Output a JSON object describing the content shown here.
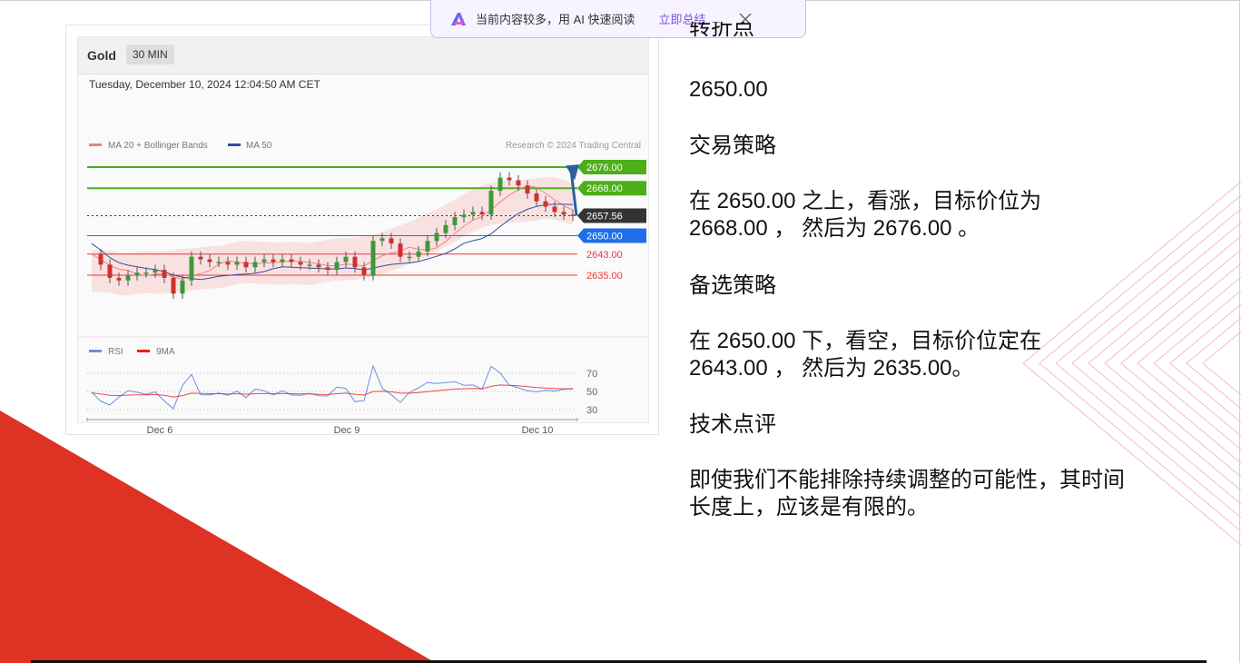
{
  "ai_banner": {
    "text": "当前内容较多，用 AI 快速阅读",
    "action": "立即总结"
  },
  "chart": {
    "symbol": "Gold",
    "timeframe": "30 MIN",
    "datetime": "Tuesday, December 10, 2024 12:04:50 AM CET",
    "legend_ma20": "MA 20 + Bollinger Bands",
    "legend_ma50": "MA 50",
    "credit": "Research © 2024 Trading Central",
    "rsi_legend": "RSI",
    "ma9_legend": "9MA"
  },
  "chart_data": {
    "type": "line",
    "title": "Gold",
    "x_ticks": [
      "Dec 6",
      "Dec 9",
      "Dec 10"
    ],
    "price_levels": [
      {
        "label": "2676.00",
        "value": 2676.0,
        "color": "#4caf1a"
      },
      {
        "label": "2668.00",
        "value": 2668.0,
        "color": "#4caf1a"
      },
      {
        "label": "2657.56",
        "value": 2657.56,
        "color": "#333333"
      },
      {
        "label": "2650.00",
        "value": 2650.0,
        "color": "#1e6fe8"
      },
      {
        "label": "2643.00",
        "value": 2643.0,
        "color": "#e8383d"
      },
      {
        "label": "2635.00",
        "value": 2635.0,
        "color": "#e8383d"
      }
    ],
    "rsi_ticks": [
      "70",
      "50",
      "30"
    ],
    "price_series": [
      2643,
      2639,
      2634,
      2633,
      2635,
      2636,
      2636,
      2637,
      2634,
      2628,
      2633,
      2642,
      2641,
      2640,
      2640,
      2639,
      2640,
      2638,
      2640,
      2641,
      2640,
      2641,
      2640,
      2639,
      2639,
      2638,
      2637,
      2640,
      2642,
      2638,
      2635,
      2648,
      2649,
      2647,
      2642,
      2642,
      2644,
      2648,
      2651,
      2654,
      2657,
      2658,
      2659,
      2658,
      2667,
      2672,
      2671,
      2669,
      2666,
      2663,
      2661,
      2659,
      2658,
      2657.56
    ],
    "series": [
      {
        "name": "MA 20 + Bollinger Bands",
        "color": "#f08080"
      },
      {
        "name": "MA 50",
        "color": "#2f4f9f"
      },
      {
        "name": "RSI",
        "color": "#6a8fe6"
      },
      {
        "name": "9MA",
        "color": "#e02020"
      }
    ]
  },
  "text": {
    "line_clipped": "转折点",
    "pivot_value": "2650.00",
    "strategy_title": "交易策略",
    "strategy_line1": "在 2650.00 之上，看涨，目标价位为",
    "strategy_line2": "2668.00 ， 然后为 2676.00 。",
    "alt_title": "备选策略",
    "alt_line1": "在 2650.00 下，看空，目标价位定在",
    "alt_line2": "2643.00 ， 然后为 2635.00。",
    "comment_title": "技术点评",
    "comment_line1": "即使我们不能排除持续调整的可能性，其时间",
    "comment_line2": "长度上，应该是有限的。"
  }
}
